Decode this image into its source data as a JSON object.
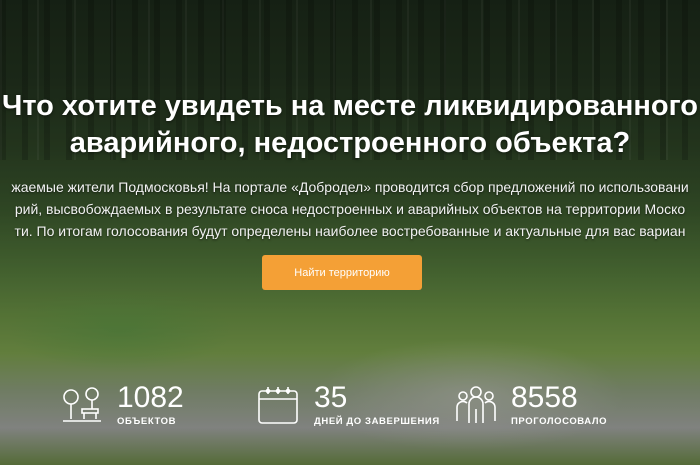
{
  "hero": {
    "title_line1": "Что хотите увидеть на месте ликвидированного",
    "title_line2": "аварийного, недостроенного объекта?",
    "intro_line1": "жаемые жители Подмосковья! На портале «Добродел» проводится сбор предложений по использовани",
    "intro_line2": "рий, высвобождаемых в результате сноса недостроенных и аварийных объектов на территории Моско",
    "intro_line3": "ти. По итогам голосования будут определены наиболее востребованные и актуальные для вас вариан",
    "cta_label": "Найти территорию",
    "cta_color": "#f4a036"
  },
  "stats": [
    {
      "icon": "park-icon",
      "value": "1082",
      "label": "ОБЪЕКТОВ"
    },
    {
      "icon": "calendar-icon",
      "value": "35",
      "label": "ДНЕЙ ДО ЗАВЕРШЕНИЯ"
    },
    {
      "icon": "people-icon",
      "value": "8558",
      "label": "ПРОГОЛОСОВАЛО"
    }
  ]
}
